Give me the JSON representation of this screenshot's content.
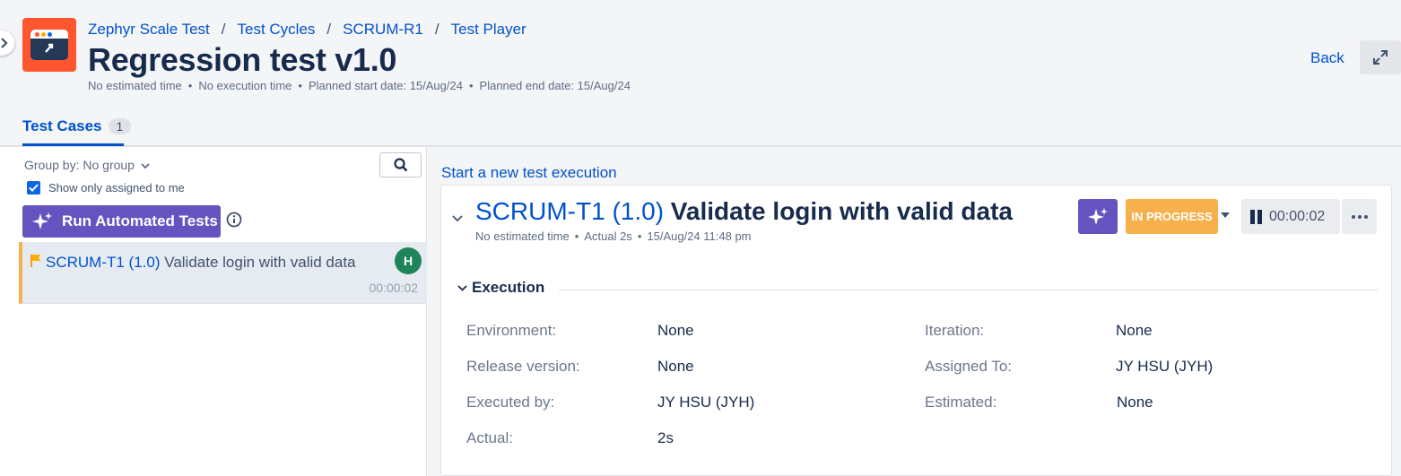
{
  "breadcrumb": [
    "Zephyr Scale Test",
    "Test Cycles",
    "SCRUM-R1",
    "Test Player"
  ],
  "page_title": "Regression test v1.0",
  "meta": [
    "No estimated time",
    "No execution time",
    "Planned start date: 15/Aug/24",
    "Planned end date: 15/Aug/24"
  ],
  "header": {
    "back_label": "Back"
  },
  "tabs": [
    {
      "label": "Test Cases",
      "count": "1"
    }
  ],
  "left_panel": {
    "group_by": "Group by: No group",
    "show_assigned_label": "Show only assigned to me",
    "run_button_label": "Run Automated Tests",
    "test_cases": [
      {
        "key": "SCRUM-T1 (1.0)",
        "name": "Validate login with valid data",
        "avatar": "H",
        "time": "00:00:02"
      }
    ]
  },
  "execution": {
    "new_execution_link": "Start a new test execution",
    "key": "SCRUM-T1 (1.0)",
    "title": "Validate login with valid data",
    "meta": [
      "No estimated time",
      "Actual 2s",
      "15/Aug/24 11:48 pm"
    ],
    "status": "IN PROGRESS",
    "timer": "00:00:02",
    "section_title": "Execution",
    "fields_left": [
      {
        "label": "Environment:",
        "value": "None"
      },
      {
        "label": "Release version:",
        "value": "None"
      },
      {
        "label": "Executed by:",
        "value": "JY HSU (JYH)"
      },
      {
        "label": "Actual:",
        "value": "2s"
      }
    ],
    "fields_right": [
      {
        "label": "Iteration:",
        "value": "None"
      },
      {
        "label": "Assigned To:",
        "value": "JY HSU (JYH)"
      },
      {
        "label": "Estimated:",
        "value": "None"
      }
    ]
  },
  "colors": {
    "accent": "#0052cc",
    "ai_purple": "#6554c0",
    "in_progress": "#f6b04c",
    "avatar": "#1f845a",
    "logo": "#ff5630"
  }
}
